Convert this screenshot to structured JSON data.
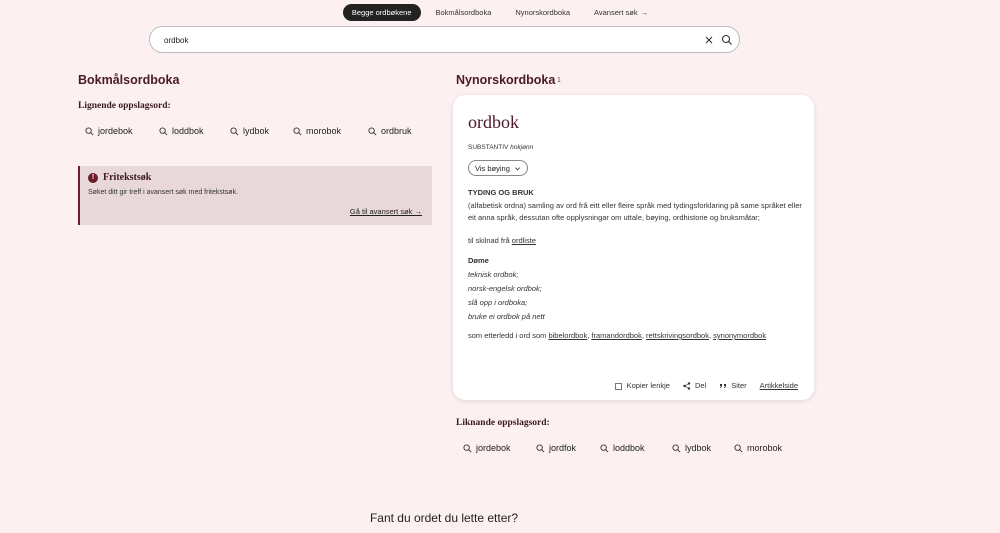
{
  "tabs": [
    {
      "label": "Begge ordbøkene",
      "active": true
    },
    {
      "label": "Bokmålsordboka",
      "active": false
    },
    {
      "label": "Nynorskordboka",
      "active": false
    },
    {
      "label": "Avansert søk",
      "active": false,
      "arrow": "→"
    }
  ],
  "search": {
    "value": "ordbok"
  },
  "bokmal": {
    "title": "Bokmålsordboka",
    "similar_title": "Lignende oppslagsord:",
    "similar": [
      "jordebok",
      "loddbok",
      "lydbok",
      "morobok",
      "ordbruk"
    ],
    "freetext": {
      "title": "Fritekstsøk",
      "desc": "Søket ditt gir treff i avansert søk med fritekstsøk.",
      "link": "Gå til avansert søk →"
    }
  },
  "nynorsk": {
    "title": "Nynorskordboka",
    "count": "1",
    "article": {
      "lemma": "ordbok",
      "pos": "SUBSTANTIV",
      "gender": "hokjønn",
      "inflect_button": "Vis bøying",
      "sense_heading": "TYDING OG BRUK",
      "definition": "(alfabetisk ordna) samling av ord frå eitt eller fleire språk med tydingsforklaring på same språket eller eit anna språk, dessutan ofte opplysningar om uttale, bøying, ordhistorie og bruksmåtar;",
      "contrast_prefix": "til skilnad frå ",
      "contrast_link": "ordliste",
      "examples_heading": "Døme",
      "examples": [
        "teknisk ordbok;",
        "norsk-engelsk ordbok;",
        "slå opp i ordboka;",
        "bruke ei ordbok på nett"
      ],
      "compound_prefix": "som etterledd i ord som ",
      "compounds": [
        "bibelordbok",
        "framandordbok",
        "rettskrivingsordbok",
        "synonymordbok"
      ],
      "actions": {
        "copy": "Kopier lenkje",
        "share": "Del",
        "cite": "Siter",
        "article": "Artikkelside"
      }
    },
    "similar_title": "Liknande oppslagsord:",
    "similar": [
      "jordebok",
      "jordfok",
      "loddbok",
      "lydbok",
      "morobok"
    ]
  },
  "footer_question": "Fant du ordet du lette etter?",
  "colors": {
    "accent": "#6e1b2c",
    "title": "#4a1a25",
    "background": "#fcf0f1"
  }
}
